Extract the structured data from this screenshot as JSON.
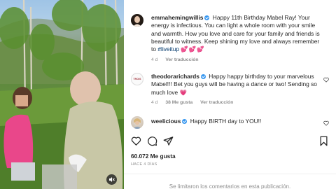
{
  "post": {
    "media": {
      "alt_icon": "muted-speaker-icon"
    },
    "comments": [
      {
        "username": "emmahemingwillis",
        "verified": true,
        "text": "Happy 11th Birthday Mabel Ray! Your energy is infectious. You can light a whole room with your smile and warmth. How you love and care for your family and friends is beautiful to witness. Keep shining my love and always remember to",
        "hashtag": "#liveitup",
        "emoji": "💕💕💕",
        "time": "4 d",
        "translate": "Ver traducción"
      },
      {
        "username": "theodorarichards",
        "verified": true,
        "text": "Happy happy birthday to your marvelous Mabel!!! Bet you guys will be having a dance or two! Sending so much love",
        "emoji": "💗",
        "time": "4 d",
        "likes": "38 Me gusta",
        "translate": "Ver traducción",
        "avatar_text": "TROIS"
      },
      {
        "username": "weelicious",
        "verified": true,
        "text": "Happy BIRTH day to YOU!!"
      }
    ],
    "likes_count": "60.072 Me gusta",
    "posted": "HACE 4 DÍAS",
    "footer": "Se limitaron los comentarios en esta publicación.",
    "icons": [
      "heart-icon",
      "comment-icon",
      "share-icon",
      "bookmark-icon"
    ],
    "colors": {
      "link": "#00376b",
      "verified": "#3797f0",
      "meta": "#8e8e8e",
      "heart_emoji": "#e6408a"
    }
  }
}
